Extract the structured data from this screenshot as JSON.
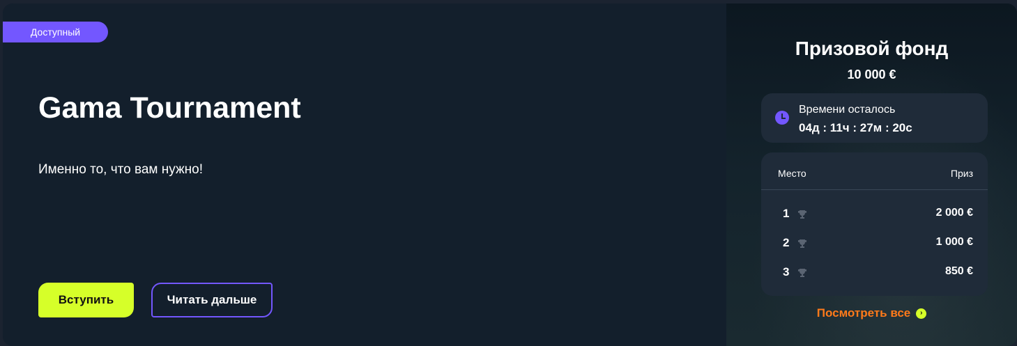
{
  "tournament": {
    "status": "Доступный",
    "title": "Gama Tournament",
    "description": "Именно то, что вам нужно!",
    "join_label": "Вступить",
    "read_more_label": "Читать дальше"
  },
  "prize_pool": {
    "title": "Призовой фонд",
    "amount": "10 000 €"
  },
  "timer": {
    "label": "Времени осталось",
    "value": "04д : 11ч : 27м : 20с"
  },
  "prize_table": {
    "headers": {
      "place": "Место",
      "prize": "Приз"
    },
    "rows": [
      {
        "place": "1",
        "prize": "2 000 €",
        "icon": "trophy-icon"
      },
      {
        "place": "2",
        "prize": "1 000 €",
        "icon": "trophy-icon"
      },
      {
        "place": "3",
        "prize": "850 €",
        "icon": "trophy-icon"
      }
    ]
  },
  "view_all": {
    "label": "Посмотреть все",
    "icon": "chevron-right-icon"
  },
  "colors": {
    "accent_purple": "#7357ff",
    "accent_lime": "#d6ff29",
    "accent_orange": "#ff7a1a",
    "card_bg": "#131f2c",
    "panel_bg": "#1f2b39"
  }
}
